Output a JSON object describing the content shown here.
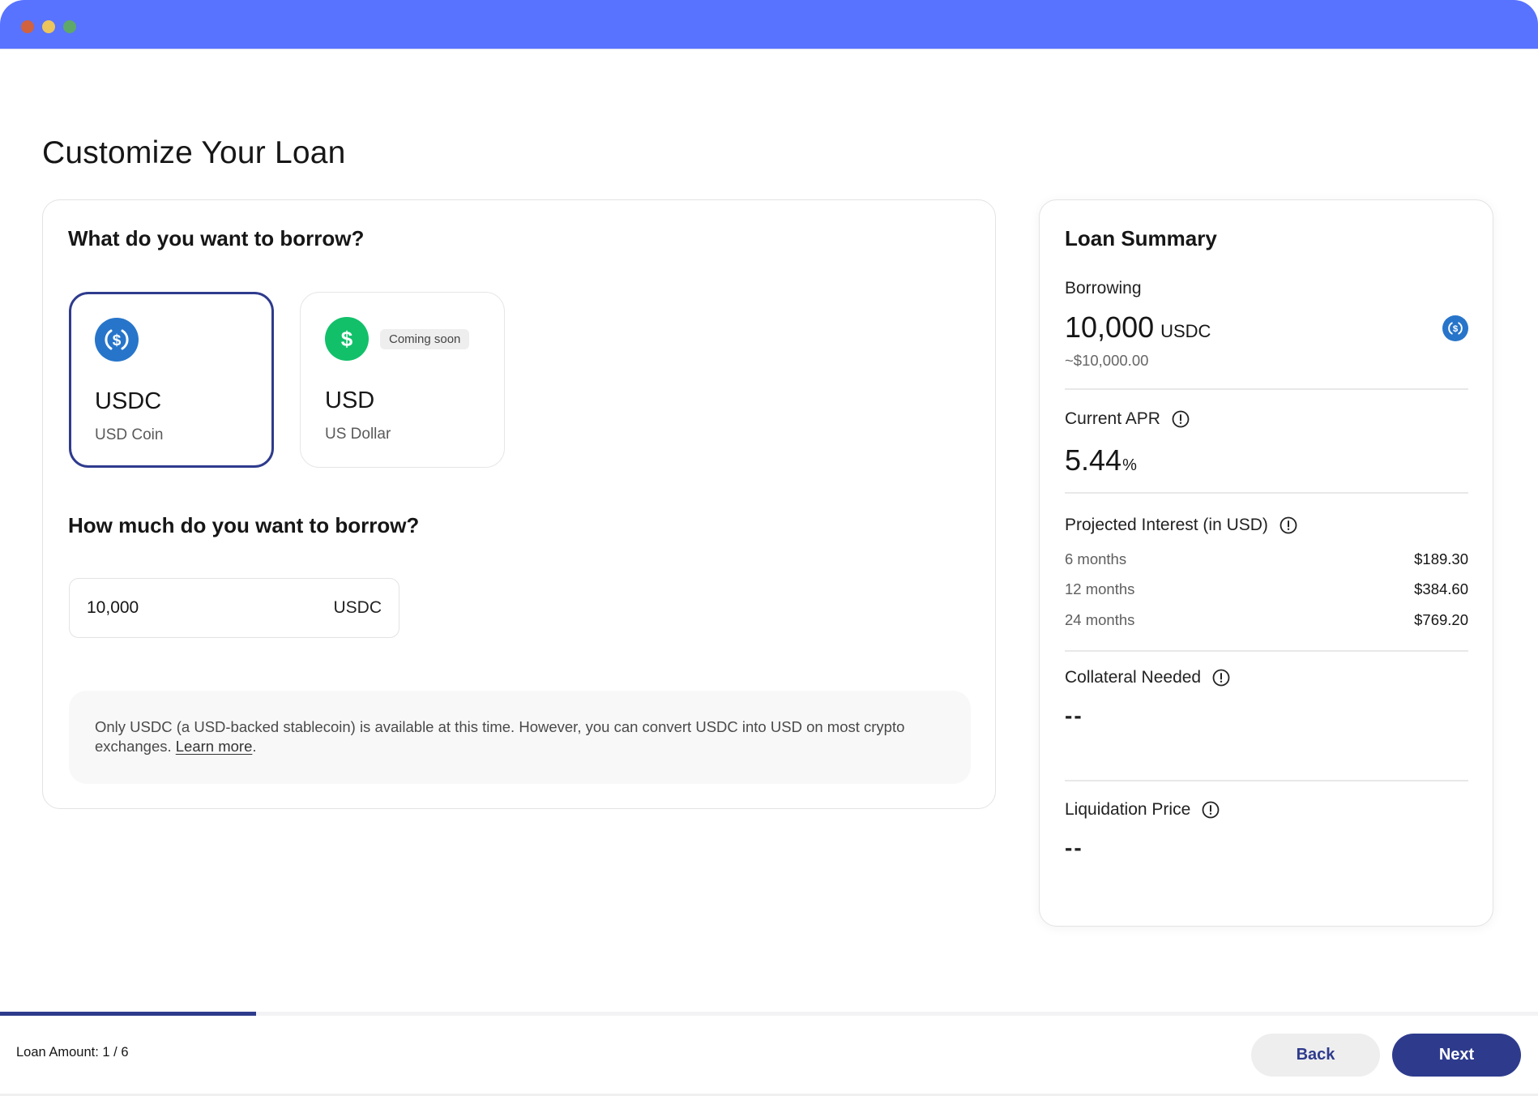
{
  "window": {
    "controls": [
      "close",
      "minimize",
      "maximize"
    ],
    "bar_color": "#5873ff"
  },
  "page": {
    "title": "Customize Your Loan"
  },
  "borrow_form": {
    "asset_heading": "What do you want to borrow?",
    "assets": [
      {
        "symbol": "USDC",
        "name": "USD Coin",
        "icon": "usdc-icon",
        "selected": true,
        "badge": null
      },
      {
        "symbol": "USD",
        "name": "US Dollar",
        "icon": "dollar-icon",
        "selected": false,
        "badge": "Coming soon"
      }
    ],
    "amount_heading": "How much do you want to borrow?",
    "amount_input": {
      "value": "10,000",
      "unit": "USDC"
    },
    "info": {
      "text": "Only USDC (a USD-backed stablecoin) is available at this time. However, you can convert USDC into USD on most crypto exchanges.",
      "link_label": "Learn more",
      "suffix": "."
    }
  },
  "summary": {
    "title": "Loan Summary",
    "borrowing": {
      "label": "Borrowing",
      "amount": "10,000",
      "unit": "USDC",
      "usd_equivalent": "~$10,000.00",
      "icon": "usdc-icon"
    },
    "apr": {
      "label": "Current APR",
      "value": "5.44",
      "unit": "%",
      "info_icon": "alert-circle-icon"
    },
    "projected_interest": {
      "label": "Projected Interest (in USD)",
      "info_icon": "alert-circle-icon",
      "rows": [
        {
          "term": "6 months",
          "amount": "$189.30"
        },
        {
          "term": "12 months",
          "amount": "$384.60"
        },
        {
          "term": "24 months",
          "amount": "$769.20"
        }
      ]
    },
    "collateral": {
      "label": "Collateral Needed",
      "value": "--",
      "info_icon": "alert-circle-icon"
    },
    "liquidation": {
      "label": "Liquidation Price",
      "value": "--",
      "info_icon": "alert-circle-icon"
    }
  },
  "footer": {
    "step_label": "Loan Amount: 1 / 6",
    "progress_fraction": 0.1667,
    "back_label": "Back",
    "next_label": "Next"
  },
  "colors": {
    "primary": "#2e3b8d",
    "usdc_blue": "#2775ca",
    "usd_green": "#12c06a"
  }
}
